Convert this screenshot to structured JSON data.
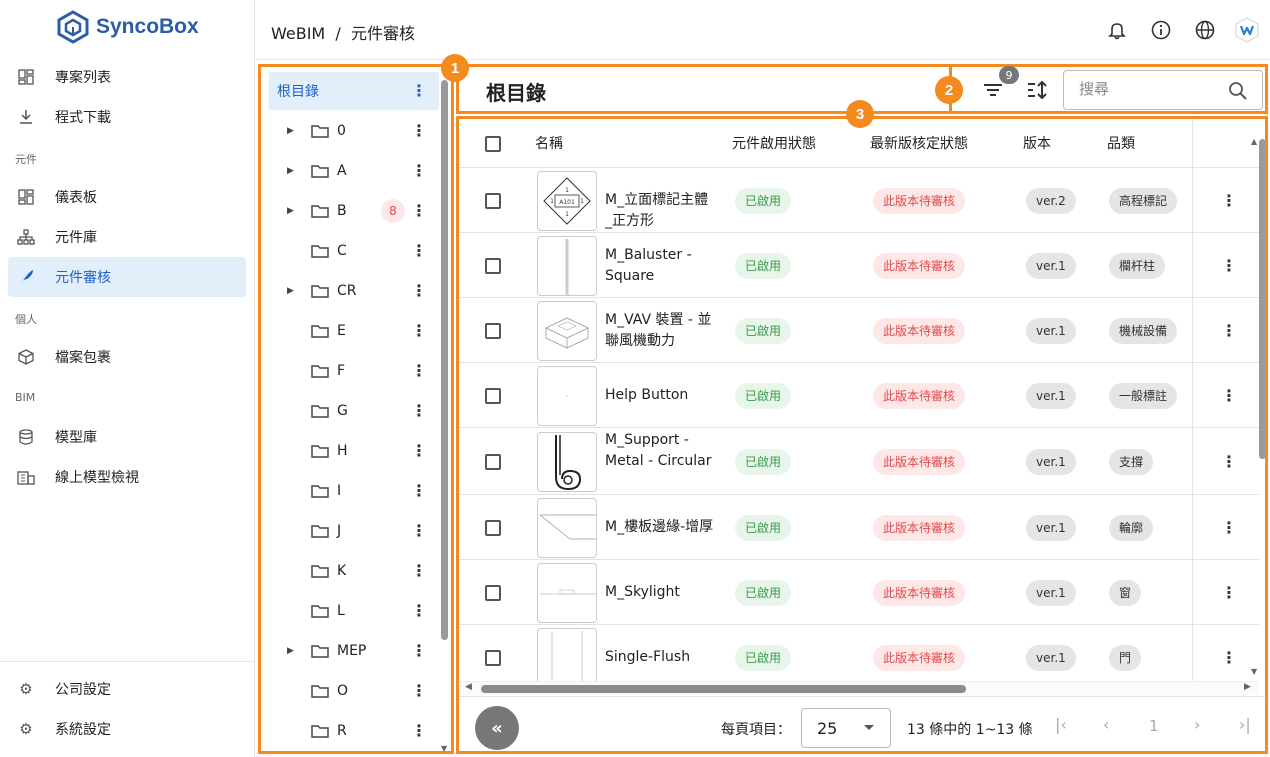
{
  "app": {
    "logo": "SyncoBox"
  },
  "sidebar": {
    "items": [
      {
        "label": "專案列表",
        "icon": "dashboard-icon"
      },
      {
        "label": "程式下載",
        "icon": "download-icon"
      },
      {
        "label": "儀表板",
        "icon": "dashboard-icon"
      },
      {
        "label": "元件庫",
        "icon": "hierarchy-icon"
      },
      {
        "label": "元件審核",
        "icon": "feather-icon"
      },
      {
        "label": "檔案包裹",
        "icon": "package-icon"
      },
      {
        "label": "模型庫",
        "icon": "database-icon"
      },
      {
        "label": "線上模型檢視",
        "icon": "building-icon"
      },
      {
        "label": "公司設定",
        "icon": "gear-icon"
      },
      {
        "label": "系統設定",
        "icon": "gear-icon"
      }
    ],
    "sections": [
      "元件",
      "個人",
      "BIM"
    ]
  },
  "header": {
    "breadcrumb": "WeBIM  /  元件審核"
  },
  "tree": {
    "root": "根目錄",
    "folders": [
      {
        "label": "0",
        "expandable": true
      },
      {
        "label": "A",
        "expandable": true
      },
      {
        "label": "B",
        "expandable": true,
        "badge": "8"
      },
      {
        "label": "C",
        "expandable": false
      },
      {
        "label": "CR",
        "expandable": true
      },
      {
        "label": "E",
        "expandable": false
      },
      {
        "label": "F",
        "expandable": false
      },
      {
        "label": "G",
        "expandable": false
      },
      {
        "label": "H",
        "expandable": false
      },
      {
        "label": "I",
        "expandable": false
      },
      {
        "label": "J",
        "expandable": false
      },
      {
        "label": "K",
        "expandable": false
      },
      {
        "label": "L",
        "expandable": false
      },
      {
        "label": "MEP",
        "expandable": true
      },
      {
        "label": "O",
        "expandable": false
      },
      {
        "label": "R",
        "expandable": false
      }
    ]
  },
  "main": {
    "title": "根目錄",
    "filter_count": "9",
    "search_placeholder": "搜尋",
    "annotations": [
      "1",
      "2",
      "3"
    ]
  },
  "table": {
    "columns": [
      "名稱",
      "元件啟用狀態",
      "最新版核定狀態",
      "版本",
      "品類"
    ],
    "rows": [
      {
        "name": "M_立面標記主體_正方形",
        "enabled": "已啟用",
        "review": "此版本待審核",
        "version": "ver.2",
        "category": "高程標記",
        "thumb": "elevation"
      },
      {
        "name": "M_Baluster - Square",
        "enabled": "已啟用",
        "review": "此版本待審核",
        "version": "ver.1",
        "category": "欄杆柱",
        "thumb": "baluster"
      },
      {
        "name": "M_VAV 裝置 - 並聯風機動力",
        "enabled": "已啟用",
        "review": "此版本待審核",
        "version": "ver.1",
        "category": "機械設備",
        "thumb": "vav"
      },
      {
        "name": "Help Button",
        "enabled": "已啟用",
        "review": "此版本待審核",
        "version": "ver.1",
        "category": "一般標註",
        "thumb": "blank"
      },
      {
        "name": "M_Support - Metal - Circular",
        "enabled": "已啟用",
        "review": "此版本待審核",
        "version": "ver.1",
        "category": "支撐",
        "thumb": "support"
      },
      {
        "name": "M_樓板邊緣-增厚",
        "enabled": "已啟用",
        "review": "此版本待審核",
        "version": "ver.1",
        "category": "輪廓",
        "thumb": "slab"
      },
      {
        "name": "M_Skylight",
        "enabled": "已啟用",
        "review": "此版本待審核",
        "version": "ver.1",
        "category": "窗",
        "thumb": "skylight"
      },
      {
        "name": "Single-Flush",
        "enabled": "已啟用",
        "review": "此版本待審核",
        "version": "ver.1",
        "category": "門",
        "thumb": "door"
      }
    ]
  },
  "footer": {
    "per_page_label": "每頁項目：",
    "per_page_value": "25",
    "range_text": "13 條中的 1~13 條",
    "current_page": "1"
  },
  "colors": {
    "accent": "#f58a1f",
    "primary": "#1e63c6"
  }
}
